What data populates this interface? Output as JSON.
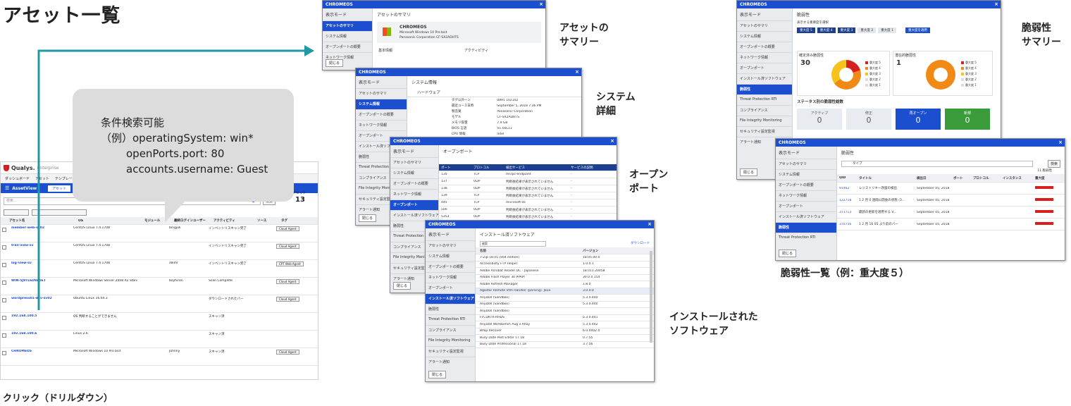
{
  "page_title": "アセット一覧",
  "callout": {
    "line1": "条件検索可能",
    "line2": "（例）operatingSystem: win*",
    "line3": "openPorts.port: 80",
    "line4": "accounts.username: Guest"
  },
  "labels": {
    "drilldown": "クリック（ドリルダウン）",
    "summary": "アセットの\nサマリー",
    "system": "システム\n詳細",
    "ports": "オープン\nポート",
    "software": "インストールされた\nソフトウェア",
    "vuln_summary": "脆弱性\nサマリー",
    "vuln_list": "脆弱性一覧（例：重大度５）"
  },
  "colors": {
    "brand": "#1c4fd0",
    "teal_arrow": "#1f9aa5",
    "severity_red": "#d62020"
  },
  "main_app": {
    "logo": "Qualys.",
    "logo_sub": "Enterprise",
    "nav": [
      "ダッシュボード",
      "アセット",
      "テンプレート"
    ],
    "tab_assets": "AssetView",
    "tab_active": "アセット",
    "search_placeholder": "検索...",
    "search_button": "検索",
    "asset_count_label": "アセット",
    "asset_count": "13",
    "col_headers": [
      "アセット名",
      "OS",
      "モジュール",
      "最終ログインユーザー",
      "アクティビティ",
      "ソース",
      "タグ"
    ],
    "rows": [
      {
        "name": "member-web-sv02",
        "os": "CentOS Linux 7.4.1708",
        "user": "bingjuk",
        "activity": "インベントリスキャン完了",
        "tag": "Cloud Agent"
      },
      {
        "name": "trail-view-sv",
        "os": "CentOS Linux 7.4.1708",
        "user": "",
        "activity": "インベントリスキャン完了",
        "tag": "Cloud Agent"
      },
      {
        "name": "log-view-sv",
        "os": "CentOS Linux 7.4.1708",
        "user": "alkmr",
        "activity": "インベントリスキャン完了",
        "tag": "CPT Web Agent"
      },
      {
        "name": "WIN-5J9TL6D9A5ET",
        "os": "Microsoft Windows Server 2008 R2 Stand",
        "user": "boyhiron",
        "activity": "Scan Complete",
        "tag": "Cloud Agent"
      },
      {
        "name": "wordpress01-dev-sv02",
        "os": "Ubuntu Linux 16.04.3",
        "user": "",
        "activity": "ダウンロードされたバー",
        "tag": "Cloud Agent"
      },
      {
        "name": "192.168.100.5",
        "os": "OS 判断することができません",
        "user": "",
        "activity": "スキャン済",
        "tag": ""
      },
      {
        "name": "192.168.100.6",
        "os": "Linux 2.6",
        "user": "",
        "activity": "スキャン済",
        "tag": ""
      },
      {
        "name": "CHROMEOS",
        "os": "Microsoft Windows 10 Pro bsit",
        "user": "Johnny",
        "activity": "スキャン済",
        "tag": "Cloud Agent"
      }
    ]
  },
  "side_menu": [
    "アセットのサマリ",
    "システム情報",
    "オープンポートの概要",
    "ネットワーク情報",
    "オープンポート",
    "インストール済ソフトウェア",
    "脆弱性",
    "Threat Protection RTI",
    "コンプライアンス",
    "File Integrity Monitoring",
    "セキュリティ設定監視",
    "アラート通知"
  ],
  "side_header": "表示モード",
  "close_btn": "閉じる",
  "win_title": "CHROMEOS",
  "w1": {
    "heading": "アセットのサマリ",
    "os_line1": "CHROMEOS",
    "os_line2": "Microsoft Windows 10 Pro bsit",
    "os_line3": "Panasonic Corporation CF-SX2ADHTS",
    "info_header": "基本情報",
    "act_header": "アクティビティ"
  },
  "w2": {
    "heading": "システム情報",
    "sub": "ハードウェア",
    "rows": [
      [
        "タグ以外ーン",
        "0891 102102"
      ],
      [
        "最近ユース日時",
        "September 5, 2018 7:36 PM"
      ],
      [
        "製造業",
        "Panasonic Corporation"
      ],
      [
        "モデル",
        "CF-SX2ADHTS"
      ],
      [
        "メモリ容量",
        "7.9 GB"
      ],
      [
        "BIOS 言語",
        "V1.00L11"
      ],
      [
        "CPU 情報",
        "Intel"
      ]
    ]
  },
  "w3": {
    "heading": "オープンポート",
    "col": [
      "ポート",
      "プロトコル",
      "検出サービス",
      "サービスの説明"
    ],
    "rows": [
      [
        "135",
        "TCP",
        "msrpc-endpoint",
        "-"
      ],
      [
        "137",
        "UDP",
        "判断後結果が表示されていません",
        "-"
      ],
      [
        "138",
        "UDP",
        "判断後結果が表示されていません",
        "-"
      ],
      [
        "139",
        "TCP",
        "判断後結果が表示されていません",
        "-"
      ],
      [
        "445",
        "TCP",
        "microsoft-ds",
        "-"
      ],
      [
        "500",
        "UDP",
        "判断後結果が表示されていません",
        "-"
      ],
      [
        "5353",
        "UDP",
        "判断後結果が表示されていません",
        "-"
      ],
      [
        "7680",
        "TCP",
        "判断後結果が表示されていません",
        "-"
      ]
    ]
  },
  "w4": {
    "heading": "インストール済ソフトウェア",
    "search_ph": "検索",
    "download": "ダウンロード",
    "col": [
      "名前",
      "バージョン"
    ],
    "rows": [
      [
        "7-Zip 18.05 (x64 edition)",
        "18.05.00.0"
      ],
      [
        "Accessibility FTP Helper",
        "1.0.0.1"
      ],
      [
        "Adobe Acrobat Reader DC - Japanese",
        "18.011.20058"
      ],
      [
        "Adobe Flash Player 30 PPAPI",
        "30.0.0.154"
      ],
      [
        "Adobe Refresh Manager",
        "1.8.0"
      ],
      [
        "Agastar Remote Vtm Handler (parsing). Java",
        "3.0.0.0"
      ],
      [
        "AnyDoll (Sandbox)",
        "5.3.0.440"
      ],
      [
        "AnyDoll (Sandbox)",
        "5.3.0.440"
      ],
      [
        "AnyDoll (Sandbox)",
        ""
      ],
      [
        "FFCDRTR-HHDS",
        "5.3.0.441"
      ],
      [
        "AnyDoll Workbench Aug x Ahoy",
        "5.3.0.442"
      ],
      [
        "BPop Recover",
        "6.0.0002.0"
      ],
      [
        "Busy Date Post Editor 17.18",
        "0.7.55"
      ],
      [
        "Busy Date Professional 17.18",
        "3.7.56"
      ]
    ]
  },
  "w5": {
    "heading": "脆弱性",
    "sub": "表示する重要度を選択",
    "sev_buttons": [
      "重大度 5",
      "重大度 4",
      "重大度 3",
      "重大度 2",
      "重大度 1"
    ],
    "apply": "重大度を適用",
    "conf_title": "確定済み脆弱性",
    "conf_count": "30",
    "pot_title": "潜在的脆弱性",
    "pot_count": "1",
    "status_title": "ステータス別の脆弱性総数",
    "status_cards": [
      {
        "label": "アクティブ",
        "value": "0"
      },
      {
        "label": "修正",
        "value": "0"
      },
      {
        "label": "再オープン",
        "value": "0"
      },
      {
        "label": "新規",
        "value": "0"
      }
    ],
    "legend": [
      "重大度 5",
      "重大度 4",
      "重大度 3",
      "重大度 2",
      "重大度 1"
    ]
  },
  "w6": {
    "heading": "脆弱性",
    "type_label": "タイプ",
    "filter_btn": "検索",
    "count": "11 脆弱性",
    "col": [
      "QID",
      "タイトル",
      "検出日",
      "ポート",
      "プロトコル",
      "インスタンス",
      "重大度"
    ],
    "rows": [
      [
        "91462",
        "レジストリキー改竄の検出",
        "September 05, 2018"
      ],
      [
        "122718",
        "1 2 月 0 週間公開後の状態 (3...",
        "September 05, 2018"
      ],
      [
        "371713",
        "最新の更新を適用する V...",
        "September 05, 2018"
      ],
      [
        "370756",
        "1 2 月 16 05 より前のバー",
        "September 05, 2018"
      ]
    ]
  }
}
